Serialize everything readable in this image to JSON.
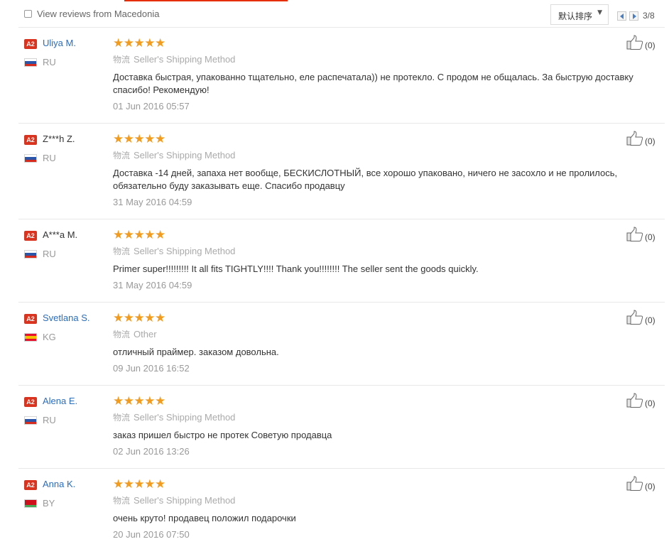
{
  "filter": {
    "checkbox_label": "View reviews from Macedonia",
    "sort_label": "默认排序",
    "page_indicator": "3/8"
  },
  "colors": {
    "accent": "#e62e04",
    "link": "#2a6dbf",
    "star": "#f29c1f",
    "badge": "#d9341f"
  },
  "reviews": [
    {
      "badge": "A2",
      "name": "Uliya M.",
      "country": "RU",
      "flag": [
        "#ffffff",
        "#2a55a8",
        "#d52b1e"
      ],
      "stars": "★★★★★",
      "shipping_cn": "物流",
      "shipping": "Seller's Shipping Method",
      "text": "Доставка быстрая, упакованно тщательно, еле распечатала)) не протекло. С продом не общалась. За быструю доставку спасибо! Рекомендую!",
      "date": "01 Jun 2016 05:57",
      "useful": "(0)"
    },
    {
      "badge": "A2",
      "name": "Z***h Z.",
      "country": "RU",
      "flag": [
        "#ffffff",
        "#2a55a8",
        "#d52b1e"
      ],
      "stars": "★★★★★",
      "shipping_cn": "物流",
      "shipping": "Seller's Shipping Method",
      "text": "Доставка -14 дней, запаха нет вообще, БЕСКИСЛОТНЫЙ, все хорошо упаковано, ничего не засохло и не пролилось, обязательно буду заказывать еще. Спасибо продавцу",
      "date": "31 May 2016 04:59",
      "useful": "(0)"
    },
    {
      "badge": "A2",
      "name": "A***a M.",
      "country": "RU",
      "flag": [
        "#ffffff",
        "#2a55a8",
        "#d52b1e"
      ],
      "stars": "★★★★★",
      "shipping_cn": "物流",
      "shipping": "Seller's Shipping Method",
      "text": "Primer super!!!!!!!!! It all fits TIGHTLY!!!! Thank you!!!!!!!! The seller sent the goods quickly.",
      "date": "31 May 2016 04:59",
      "useful": "(0)"
    },
    {
      "badge": "A2",
      "name": "Svetlana S.",
      "country": "KG",
      "flag": [
        "#e8112d",
        "#f5c200",
        "#e8112d"
      ],
      "stars": "★★★★★",
      "shipping_cn": "物流",
      "shipping": "Other",
      "text": "отличный праймер. заказом довольна.",
      "date": "09 Jun 2016 16:52",
      "useful": "(0)"
    },
    {
      "badge": "A2",
      "name": "Alena E.",
      "country": "RU",
      "flag": [
        "#ffffff",
        "#2a55a8",
        "#d52b1e"
      ],
      "stars": "★★★★★",
      "shipping_cn": "物流",
      "shipping": "Seller's Shipping Method",
      "text": "заказ пришел быстро не протек Советую продавца",
      "date": "02 Jun 2016 13:26",
      "useful": "(0)"
    },
    {
      "badge": "A2",
      "name": "Anna K.",
      "country": "BY",
      "flag": [
        "#cf101a",
        "#cf101a",
        "#4aa657"
      ],
      "stars": "★★★★★",
      "shipping_cn": "物流",
      "shipping": "Seller's Shipping Method",
      "text": "очень круто! продавец положил подарочки",
      "date": "20 Jun 2016 07:50",
      "useful": "(0)"
    }
  ]
}
